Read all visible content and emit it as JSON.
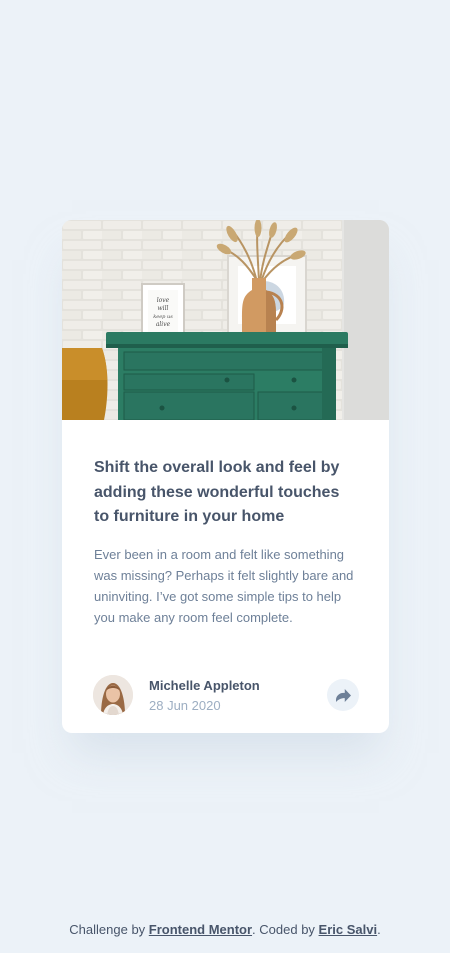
{
  "card": {
    "image_alt": "drawers",
    "frame_text": [
      "love",
      "will",
      "keep us",
      "alive"
    ],
    "title": "Shift the overall look and feel by adding these wonderful touches to furniture in your home",
    "excerpt": "Ever been in a room and felt like something was missing? Perhaps it felt slightly bare and uninviting. I’ve got some simple tips to help you make any room feel complete.",
    "author": {
      "name": "Michelle Appleton",
      "date": "28 Jun 2020"
    },
    "share_icon": "share-icon"
  },
  "attribution": {
    "prefix": "Challenge by ",
    "challenge_link": "Frontend Mentor",
    "middle": ". Coded by ",
    "author_link": "Eric Salvi",
    "suffix": "."
  },
  "colors": {
    "background": "#ECF2F8",
    "card": "#FFFFFF",
    "title": "#48556A",
    "text": "#6E8098",
    "muted": "#9DAEC2",
    "drawer": "#2A7A63"
  }
}
